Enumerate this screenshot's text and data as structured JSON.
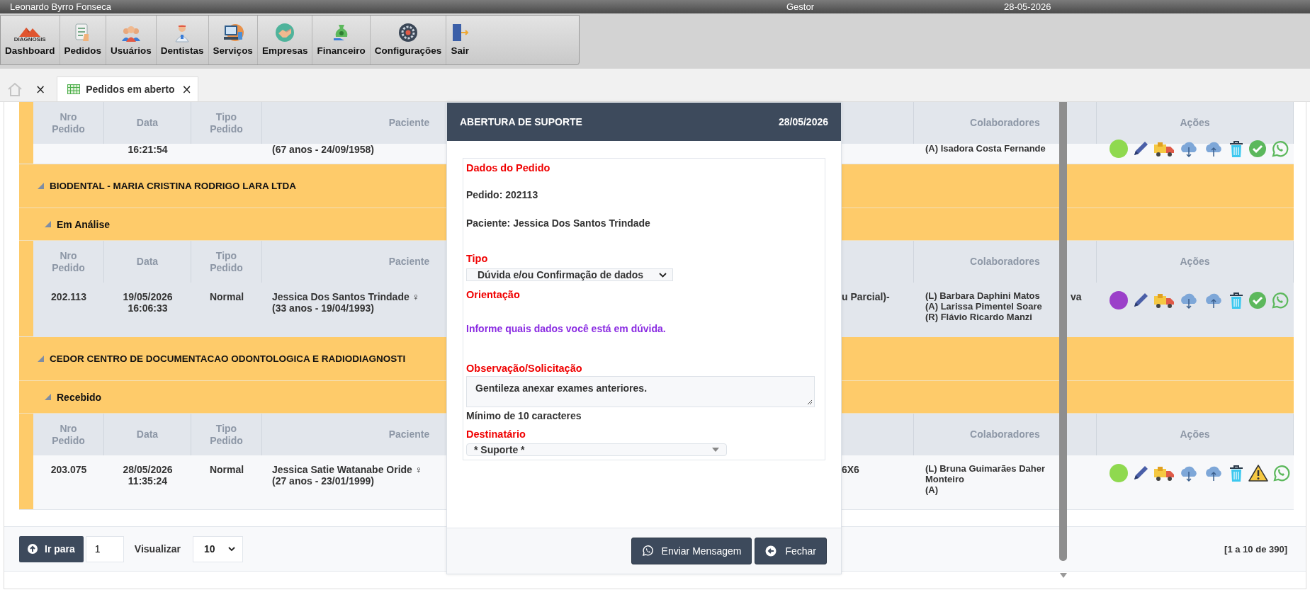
{
  "top_bar": {
    "user": "Leonardo Byrro Fonseca",
    "role": "Gestor",
    "date": "28-05-2026"
  },
  "toolbar": [
    {
      "label": "Dashboard",
      "logo_text": "DIAGNOSIS"
    },
    {
      "label": "Pedidos"
    },
    {
      "label": "Usuários"
    },
    {
      "label": "Dentistas"
    },
    {
      "label": "Serviços"
    },
    {
      "label": "Empresas"
    },
    {
      "label": "Financeiro"
    },
    {
      "label": "Configurações"
    },
    {
      "label": "Sair"
    }
  ],
  "tabs": [
    {
      "kind": "home",
      "close": "×",
      "selected": false
    },
    {
      "kind": "page",
      "label": "Pedidos em aberto",
      "close": "×",
      "selected": true
    }
  ],
  "table": {
    "blocks": [
      {
        "kind": "header",
        "columns": [
          "Nro\nPedido",
          "Data",
          "Tipo\nPedido",
          "Paciente",
          "Colaboradores",
          "Ações"
        ]
      },
      {
        "kind": "partial_row",
        "date": "16:21:54",
        "patient": "(67 anos - 24/09/1958)",
        "collaborators": [
          "(A) Isadora Costa Fernande"
        ],
        "color": "#8fd94f",
        "warning": false
      },
      {
        "kind": "group",
        "label": "BIODENTAL - MARIA CRISTINA RODRIGO LARA LTDA",
        "expanded": true
      },
      {
        "kind": "subgroup",
        "label": "Em Análise",
        "expanded": true
      },
      {
        "kind": "header",
        "columns": [
          "Nro\nPedido",
          "Data",
          "Tipo\nPedido",
          "Paciente",
          "Colaboradores",
          "Ações"
        ]
      },
      {
        "kind": "row",
        "nro": "202.113",
        "date": "19/05/2026\n16:06:33",
        "type": "Normal",
        "patient": "Jessica Dos Santos Trindade ♀\n(33 anos - 19/04/1993)",
        "fragment": "u Parcial)-",
        "collaborators": [
          "(L) Barbara Daphini Matos",
          "(A) Larissa Pimentel Soare",
          "(R) Flávio Ricardo Manzi"
        ],
        "overflow": "va",
        "color": "#9b3fc9",
        "warning": false
      },
      {
        "kind": "group",
        "label": "CEDOR CENTRO DE DOCUMENTACAO ODONTOLOGICA E RADIODIAGNOSTI",
        "expanded": true
      },
      {
        "kind": "subgroup",
        "label": "Recebido",
        "expanded": true
      },
      {
        "kind": "header",
        "columns": [
          "Nro\nPedido",
          "Data",
          "Tipo\nPedido",
          "Paciente",
          "Colaboradores",
          "Ações"
        ]
      },
      {
        "kind": "row",
        "nro": "203.075",
        "date": "28/05/2026\n11:35:24",
        "type": "Normal",
        "patient": "Jessica Satie Watanabe Oride ♀\n(27 anos - 23/01/1999)",
        "fragment": "6X6",
        "collaborators": [
          "(L) Bruna Guimarães Daher",
          "Monteiro",
          "(A)"
        ],
        "color": "#8fd94f",
        "warning": true
      }
    ]
  },
  "pagination": {
    "goto_label": "Ir para",
    "page": "1",
    "view_label": "Visualizar",
    "page_size": "10",
    "summary": "[1 a 10 de 390]"
  },
  "modal": {
    "title": "ABERTURA DE SUPORTE",
    "date": "28/05/2026",
    "section_title": "Dados do Pedido",
    "order": "Pedido: 202113",
    "patient": "Paciente: Jessica Dos Santos Trindade",
    "type_label": "Tipo",
    "type_value": "Dúvida e/ou Confirmação de dados",
    "guidance_label": "Orientação",
    "guidance": "Informe quais dados você está em dúvida.",
    "note_label": "Observação/Solicitação",
    "note": "Gentileza anexar exames anteriores.",
    "note_hint": "Mínimo de 10 caracteres",
    "recipient_label": "Destinatário",
    "recipient": "* Suporte *",
    "buttons": [
      {
        "kind": "send",
        "label": "Enviar Mensagem"
      },
      {
        "kind": "close",
        "label": "Fechar"
      }
    ]
  }
}
